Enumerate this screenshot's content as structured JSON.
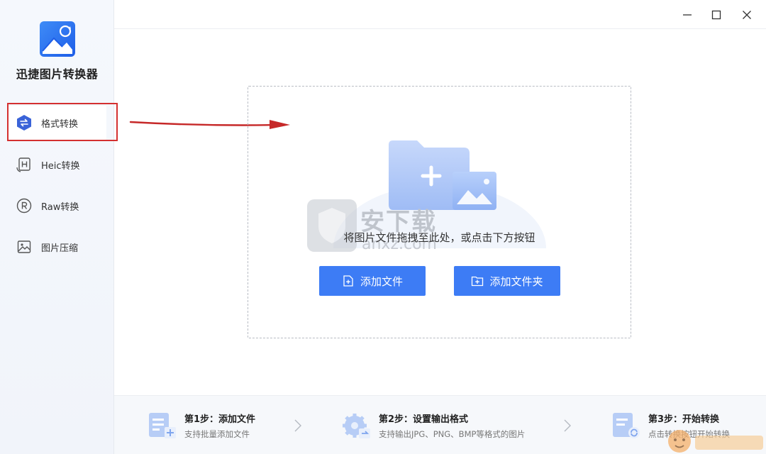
{
  "app": {
    "title": "迅捷图片转换器"
  },
  "sidebar": {
    "items": [
      {
        "label": "格式转换",
        "icon": "swap-icon",
        "active": true
      },
      {
        "label": "Heic转换",
        "icon": "heic-icon",
        "active": false
      },
      {
        "label": "Raw转换",
        "icon": "raw-icon",
        "active": false
      },
      {
        "label": "图片压缩",
        "icon": "image-compress-icon",
        "active": false
      }
    ]
  },
  "window_controls": {
    "minimize": "minimize-icon",
    "maximize": "maximize-icon",
    "close": "close-icon"
  },
  "dropzone": {
    "instruction": "将图片文件拖拽至此处，或点击下方按钮",
    "add_file_label": "添加文件",
    "add_folder_label": "添加文件夹"
  },
  "watermark": {
    "text": "安下载",
    "sub": "anxz.com"
  },
  "steps": [
    {
      "title": "第1步：添加文件",
      "desc": "支持批量添加文件"
    },
    {
      "title": "第2步：设置输出格式",
      "desc": "支持输出JPG、PNG、BMP等格式的图片"
    },
    {
      "title": "第3步：开始转换",
      "desc": "点击转换按钮开始转换"
    }
  ],
  "colors": {
    "accent": "#3d7cf5",
    "annotation": "#d43030",
    "sidebar_bg": "#f3f6fb"
  }
}
